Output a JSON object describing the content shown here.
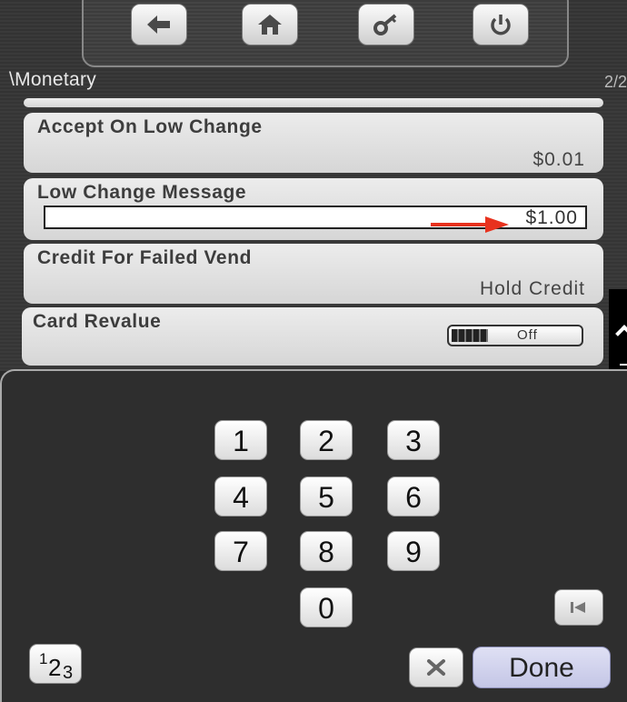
{
  "header": {
    "breadcrumb": "\\Monetary",
    "page_indicator": "2/2",
    "buttons": [
      {
        "icon": "back-arrow-icon"
      },
      {
        "icon": "home-icon"
      },
      {
        "icon": "key-icon"
      },
      {
        "icon": "power-icon"
      }
    ]
  },
  "settings": {
    "accept_low_change": {
      "title": "Accept On Low Change",
      "value": "$0.01"
    },
    "low_change_message": {
      "title": "Low Change Message",
      "value": "$1.00"
    },
    "credit_failed_vend": {
      "title": "Credit For Failed Vend",
      "value": "Hold Credit"
    },
    "card_revalue": {
      "title": "Card Revalue",
      "toggle_label": "Off"
    }
  },
  "keypad": {
    "keys": [
      "1",
      "2",
      "3",
      "4",
      "5",
      "6",
      "7",
      "8",
      "9",
      "0"
    ],
    "mode_label": {
      "sup": "1",
      "main": "2",
      "sub": "3"
    },
    "done_label": "Done"
  },
  "colors": {
    "annotation_arrow": "#e8321e",
    "done_button": "#c8cae8",
    "panel_background": "#2e2e2e"
  }
}
